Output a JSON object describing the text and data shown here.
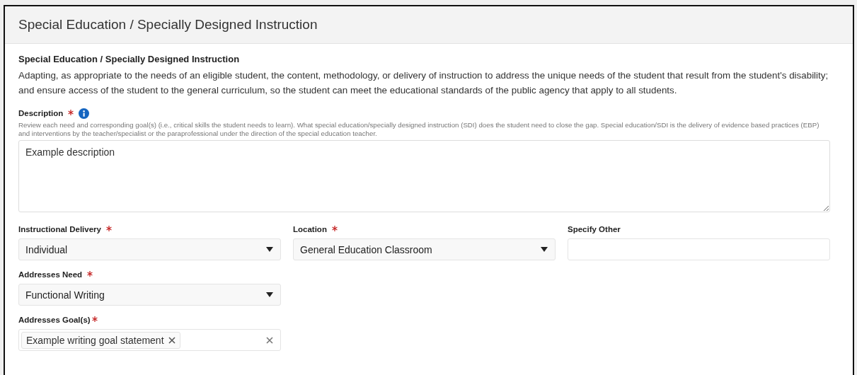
{
  "panel": {
    "title": "Special Education / Specially Designed Instruction"
  },
  "section": {
    "heading": "Special Education / Specially Designed Instruction",
    "text": "Adapting, as appropriate to the needs of an eligible student, the content, methodology, or delivery of instruction to address the unique needs of the student that result from the student's disability; and ensure access of the student to the general curriculum, so the student can meet the educational standards of the public agency that apply to all students."
  },
  "description": {
    "label": "Description",
    "required": true,
    "info": true,
    "help": "Review each need and corresponding goal(s) (i.e., critical skills the student needs to learn). What special education/specially designed instruction (SDI) does the student need to close the gap. Special education/SDI is the delivery of evidence based practices (EBP) and interventions by the teacher/specialist or the paraprofessional under the direction of the special education teacher.",
    "value": "Example description"
  },
  "rows": [
    {
      "fields": [
        {
          "kind": "select",
          "label": "Instructional Delivery",
          "required": true,
          "value": "Individual"
        },
        {
          "kind": "select",
          "label": "Location",
          "required": true,
          "value": "General Education Classroom"
        },
        {
          "kind": "text",
          "label": "Specify Other",
          "required": false
        }
      ]
    },
    {
      "fields": [
        {
          "kind": "select",
          "label": "Addresses Need",
          "required": true,
          "value": "Functional Writing"
        }
      ]
    },
    {
      "fields": [
        {
          "kind": "multiselect",
          "label": "Addresses Goal(s)",
          "required": true,
          "tags": [
            "Example writing goal statement"
          ]
        }
      ]
    }
  ]
}
